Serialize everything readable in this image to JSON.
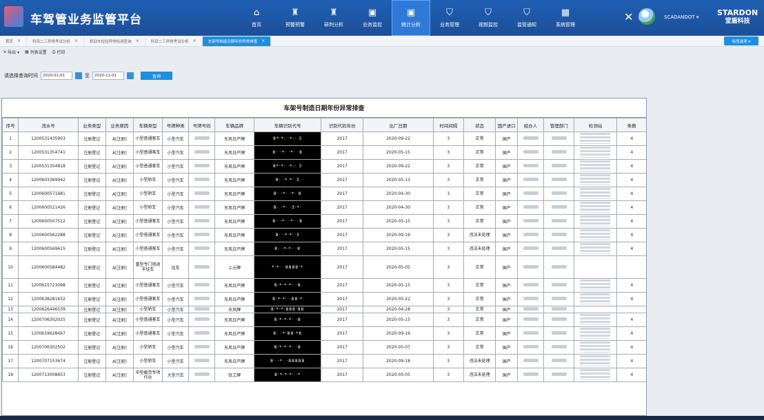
{
  "header": {
    "title": "车驾管业务监管平台",
    "nav": [
      {
        "icon": "home-icon",
        "glyph": "⌂",
        "label": "首页"
      },
      {
        "icon": "alarm-icon",
        "glyph": "♜",
        "label": "预警预警"
      },
      {
        "icon": "alarm-icon",
        "glyph": "♜",
        "label": "研判分析"
      },
      {
        "icon": "monitor-icon",
        "glyph": "▣",
        "label": "业务监控"
      },
      {
        "icon": "stats-icon",
        "glyph": "▣",
        "label": "统计分析"
      },
      {
        "icon": "shield-icon",
        "glyph": "⛉",
        "label": "业务管理"
      },
      {
        "icon": "shield-icon",
        "glyph": "⛉",
        "label": "视频监控"
      },
      {
        "icon": "shield-icon",
        "glyph": "⛉",
        "label": "监管通知"
      },
      {
        "icon": "grid-icon",
        "glyph": "▦",
        "label": "系统管理"
      }
    ],
    "username": "SCADANDOT ▾",
    "brand_line1": "STARDON",
    "brand_line2": "堂盾科技"
  },
  "tabs": [
    {
      "label": "首页",
      "active": false
    },
    {
      "label": "科目二三异常考试分析",
      "active": false
    },
    {
      "label": "机动车检验异常检测查询",
      "active": false
    },
    {
      "label": "科目二三异常考试分析",
      "active": false
    },
    {
      "label": "车架号制造日期年份异常排查",
      "active": true
    }
  ],
  "more_label": "标签选项 ▾",
  "toolbar": {
    "export": "导出 ▾",
    "config": "列表设置",
    "print": "打印"
  },
  "query": {
    "label": "请选择查询时间",
    "start": "2020-01-01",
    "to": "至",
    "end": "2020-11-01",
    "button": "查询"
  },
  "report": {
    "title": "车架号制造日期年份异常排查",
    "columns": [
      "序号",
      "流水号",
      "业务类型",
      "业务原因",
      "车辆类型",
      "号牌种类",
      "号牌号码",
      "车辆品牌",
      "车辆识别代号",
      "识别代码年份",
      "出厂日期",
      "时间间隔",
      "状态",
      "国产进口",
      "经办人",
      "管理部门",
      "检测站",
      "条数"
    ],
    "rows": [
      [
        "1",
        "1200531435903",
        "注册登记",
        "A[注册]",
        "小型普通客车",
        "小型汽车",
        "",
        "东风日产牌",
        "8*·*·  ·*-·  3",
        "2017",
        "2020-09-22",
        "3",
        "正常",
        "国产",
        "",
        "",
        "",
        "4"
      ],
      [
        "2",
        "1200531354741",
        "注册登记",
        "A[注册]",
        "小型普通客车",
        "小型汽车",
        "",
        "东风日产牌",
        "8·  ·*·  ·*·  ·8",
        "2017",
        "2020-05-15",
        "3",
        "正常",
        "国产",
        "",
        "",
        "",
        "4"
      ],
      [
        "3",
        "1200531354818",
        "注册登记",
        "A[注册]",
        "小型普通客车",
        "小型汽车",
        "",
        "东风日产牌",
        "8*·*·  ·*-·  3",
        "2017",
        "2020-09-22",
        "3",
        "正常",
        "国产",
        "",
        "",
        "",
        "4"
      ],
      [
        "4",
        "1200603369942",
        "注册登记",
        "A[注册]",
        "小型轿车",
        "小型汽车",
        "",
        "东风日产牌",
        "8·  ·*·*·  3",
        "2017",
        "2020-05-13",
        "3",
        "正常",
        "国产",
        "",
        "",
        "",
        "4"
      ],
      [
        "5",
        "1200600571681",
        "注册登记",
        "A[注册]",
        "小型轿车",
        "小型汽车",
        "",
        "东风日产牌",
        "8·  ·*·  ·*·  8",
        "2017",
        "2020-04-30",
        "3",
        "正常",
        "国产",
        "",
        "",
        "",
        "4"
      ],
      [
        "6",
        "1200600521426",
        "注册登记",
        "A[注册]",
        "小型轿车",
        "小型汽车",
        "",
        "东风日产牌",
        "8·  ·*·  ·3·*·",
        "2017",
        "2020-04-30",
        "3",
        "正常",
        "国产",
        "",
        "",
        "",
        "4"
      ],
      [
        "7",
        "1200600507512",
        "注册登记",
        "A[注册]",
        "小型普通客车",
        "小型汽车",
        "",
        "东风日产牌",
        "8·  ·*·  ·*·  ·8",
        "2017",
        "2020-05-15",
        "3",
        "正常",
        "国产",
        "",
        "",
        "",
        "4"
      ],
      [
        "8",
        "1200600562288",
        "注册登记",
        "A[注册]",
        "小型普通客车",
        "小型汽车",
        "",
        "东风日产牌",
        "8·  ·*·*·  3",
        "2017",
        "2020-09-19",
        "3",
        "违法未处理",
        "国产",
        "",
        "",
        "",
        "4"
      ],
      [
        "9",
        "1200600569615",
        "注册登记",
        "A[注册]",
        "小型普通客车",
        "小型汽车",
        "",
        "东风日产牌",
        "8·  ·*·*·  ·8",
        "2017",
        "2020-05-15",
        "3",
        "违法未处理",
        "国产",
        "",
        "",
        "",
        "4"
      ],
      [
        "10",
        "1200600584482",
        "注册登记",
        "A[注册]",
        "重型专门用途半挂车",
        "挂车",
        "",
        "上元牌",
        "*·*·  ·8888·*",
        "2017",
        "2020-05-05",
        "3",
        "正常",
        "国产",
        "",
        "",
        "",
        ""
      ],
      [
        "11",
        "1200615723098",
        "注册登记",
        "A[注册]",
        "小型普通客车",
        "小型汽车",
        "",
        "东风日产牌",
        "8·*·*·*·  ·8",
        "2017",
        "2020-05-15",
        "3",
        "正常",
        "国产",
        "",
        "",
        "",
        "4"
      ],
      [
        "12",
        "1200638281632",
        "注册登记",
        "A[注册]",
        "小型普通客车",
        "小型汽车",
        "",
        "东风日产牌",
        "8·*·*·  ·88·*",
        "2017",
        "2020-05-22",
        "3",
        "正常",
        "国产",
        "",
        "",
        "",
        "4"
      ],
      [
        "13",
        "1200626446539",
        "注册登记",
        "A[注册]",
        "小型轿车",
        "小型汽车",
        "",
        "东风牌",
        "8·*·*·888·88",
        "2017",
        "2020-04-28",
        "3",
        "正常",
        "国产",
        "",
        "",
        "",
        ""
      ],
      [
        "14",
        "1200706302025",
        "注册登记",
        "A[注册]",
        "小型普通客车",
        "小型汽车",
        "",
        "东风日产牌",
        "8·*·*·*·  ·8",
        "2017",
        "2020-05-15",
        "3",
        "正常",
        "国产",
        "",
        "",
        "",
        "4"
      ],
      [
        "15",
        "1200619628497",
        "注册登记",
        "A[注册]",
        "小型普通客车",
        "小型汽车",
        "",
        "东风日产牌",
        "8·  ·*·88·*8",
        "2017",
        "2020-09-19",
        "3",
        "正常",
        "国产",
        "",
        "",
        "",
        "4"
      ],
      [
        "16",
        "1200706302502",
        "注册登记",
        "A[注册]",
        "小型轿车",
        "小型汽车",
        "",
        "东风日产牌",
        "8·*·*·*·  ·8",
        "2017",
        "2020-05-07",
        "3",
        "正常",
        "国产",
        "",
        "",
        "",
        "4"
      ],
      [
        "17",
        "1200707153674",
        "注册登记",
        "A[注册]",
        "小型轿车",
        "小型汽车",
        "",
        "东风日产牌",
        "8·  ·*·  ·88888",
        "2017",
        "2020-09-18",
        "3",
        "违法未处理",
        "国产",
        "",
        "",
        "",
        "4"
      ],
      [
        "18",
        "1200713008653",
        "注册登记",
        "A[注册]",
        "中型载货专项作业",
        "大型汽车",
        "",
        "钛工牌",
        "8·*·*·*·  ·*",
        "2017",
        "2020-05-05",
        "3",
        "违法未处理",
        "国产",
        "",
        "",
        "",
        "4"
      ]
    ]
  }
}
